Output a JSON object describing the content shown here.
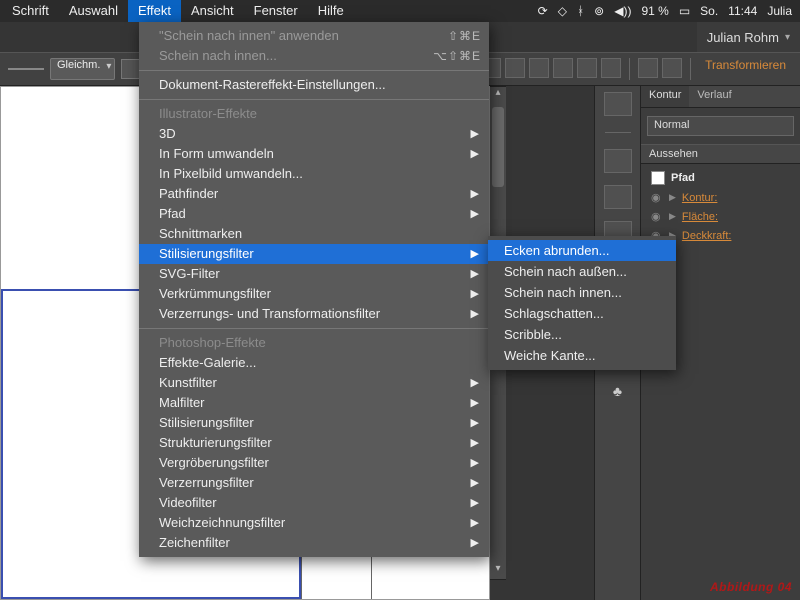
{
  "menubar": {
    "items": [
      "Schrift",
      "Auswahl",
      "Effekt",
      "Ansicht",
      "Fenster",
      "Hilfe"
    ],
    "active_index": 2
  },
  "system_status": {
    "battery_pct": "91 %",
    "day": "So.",
    "time": "11:44",
    "user_short": "Julia"
  },
  "userbar": {
    "name": "Julian Rohm"
  },
  "optionsbar": {
    "stroke_profile": "Gleichm.",
    "transform_label": "Transformieren"
  },
  "effect_menu": {
    "recent_apply": "\"Schein nach innen\" anwenden",
    "recent_apply_sc": "⇧⌘E",
    "recent_reapply": "Schein nach innen...",
    "recent_reapply_sc": "⌥⇧⌘E",
    "doc_raster": "Dokument-Rastereffekt-Einstellungen...",
    "section1": "Illustrator-Effekte",
    "items1": [
      {
        "label": "3D",
        "arrow": true
      },
      {
        "label": "In Form umwandeln",
        "arrow": true
      },
      {
        "label": "In Pixelbild umwandeln...",
        "arrow": false
      },
      {
        "label": "Pathfinder",
        "arrow": true
      },
      {
        "label": "Pfad",
        "arrow": true
      },
      {
        "label": "Schnittmarken",
        "arrow": false
      },
      {
        "label": "Stilisierungsfilter",
        "arrow": true,
        "hl": true
      },
      {
        "label": "SVG-Filter",
        "arrow": true
      },
      {
        "label": "Verkrümmungsfilter",
        "arrow": true
      },
      {
        "label": "Verzerrungs- und Transformationsfilter",
        "arrow": true
      }
    ],
    "section2": "Photoshop-Effekte",
    "items2": [
      {
        "label": "Effekte-Galerie...",
        "arrow": false
      },
      {
        "label": "Kunstfilter",
        "arrow": true
      },
      {
        "label": "Malfilter",
        "arrow": true
      },
      {
        "label": "Stilisierungsfilter",
        "arrow": true
      },
      {
        "label": "Strukturierungsfilter",
        "arrow": true
      },
      {
        "label": "Vergröberungsfilter",
        "arrow": true
      },
      {
        "label": "Verzerrungsfilter",
        "arrow": true
      },
      {
        "label": "Videofilter",
        "arrow": true
      },
      {
        "label": "Weichzeichnungsfilter",
        "arrow": true
      },
      {
        "label": "Zeichenfilter",
        "arrow": true
      }
    ]
  },
  "submenu": {
    "items": [
      {
        "label": "Ecken abrunden...",
        "hl": true
      },
      {
        "label": "Schein nach außen..."
      },
      {
        "label": "Schein nach innen..."
      },
      {
        "label": "Schlagschatten..."
      },
      {
        "label": "Scribble..."
      },
      {
        "label": "Weiche Kante..."
      }
    ]
  },
  "panels": {
    "tabs": [
      "Kontur",
      "Verlauf"
    ],
    "blend_mode": "Normal",
    "appearance_title": "Aussehen",
    "object_label": "Pfad",
    "rows": [
      {
        "label": "Kontur:"
      },
      {
        "label": "Fläche:"
      },
      {
        "label": "Deckkraft:"
      }
    ]
  },
  "watermark": "Abbildung 04"
}
